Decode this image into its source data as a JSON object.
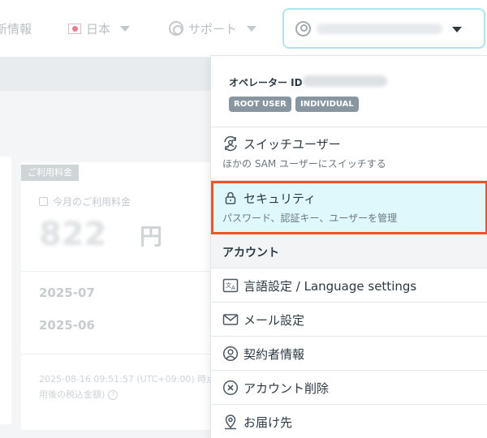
{
  "header": {
    "news_label": "新情報",
    "language_label": "日本",
    "support_label": "サポート"
  },
  "background": {
    "billing_tag": "ご利用料金",
    "billing_label": "今月のご利用料金",
    "billing_amount": "822",
    "billing_unit": "円",
    "months": [
      "2025-07",
      "2025-06"
    ],
    "note_line1": "2025-08-16 09:51:57 (UTC+09:00) 時点",
    "note_line2": "用後の税込金額)"
  },
  "menu": {
    "operator_label": "オペレーター ID",
    "badges": [
      "ROOT USER",
      "INDIVIDUAL"
    ],
    "switch_user": {
      "title": "スイッチユーザー",
      "subtitle": "ほかの SAM ユーザーにスイッチする"
    },
    "security": {
      "title": "セキュリティ",
      "subtitle": "パスワード、認証キー、ユーザーを管理"
    },
    "account_section": "アカウント",
    "items": [
      {
        "label": "言語設定 / Language settings",
        "icon": "language-icon"
      },
      {
        "label": "メール設定",
        "icon": "mail-icon"
      },
      {
        "label": "契約者情報",
        "icon": "contract-person-icon"
      },
      {
        "label": "アカウント削除",
        "icon": "delete-circle-icon"
      },
      {
        "label": "お届け先",
        "icon": "location-pin-icon"
      }
    ]
  },
  "colors": {
    "highlight_border": "#f0532a",
    "highlight_bg": "#dff8fb",
    "account_button_border": "#a9e6ef",
    "badge_bg": "#8796a0"
  }
}
